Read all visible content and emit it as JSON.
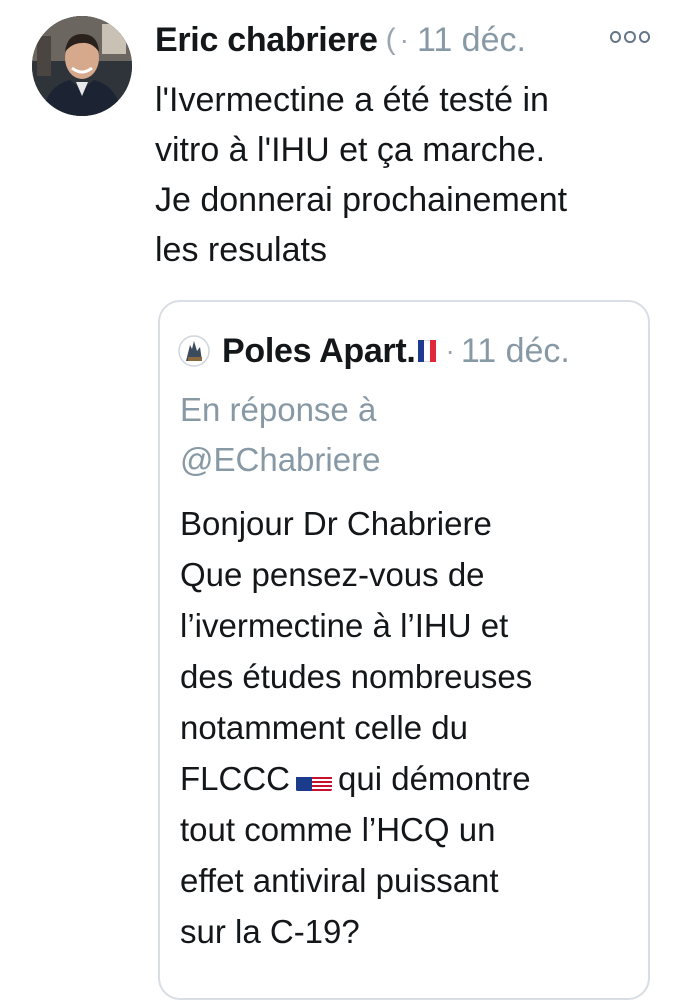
{
  "tweet": {
    "author_name": "Eric chabriere",
    "author_handle": "(",
    "separator": "·",
    "timestamp": "11 déc.",
    "more_icon": "more-options-icon",
    "text_lines": [
      "l'Ivermectine a été testé in",
      "vitro à l'IHU et ça marche.",
      "Je donnerai prochainement",
      "les resulats"
    ]
  },
  "quoted_tweet": {
    "author_name": "Poles Apart.",
    "separator": "·",
    "timestamp": "11 déc.",
    "reply_label": "En réponse à",
    "reply_handle": "@EChabriere",
    "text_lines": [
      "Bonjour Dr Chabriere",
      "Que pensez-vous de",
      "l’ivermectine à l’IHU et",
      "des études nombreuses",
      "notamment celle du"
    ],
    "flag_line_before": "FLCCC",
    "flag_line_after": "qui démontre",
    "text_lines_after": [
      "tout comme l’HCQ un",
      "effet antiviral puissant",
      "sur la C-19?"
    ],
    "flags": {
      "author_flag": "france-flag-icon",
      "inline_flag": "usa-flag-icon"
    }
  },
  "colors": {
    "text": "#14171a",
    "muted": "#8899a6",
    "border": "#d8dee3",
    "fr_blue": "#1f3a93",
    "fr_white": "#ffffff",
    "fr_red": "#e0283a"
  }
}
